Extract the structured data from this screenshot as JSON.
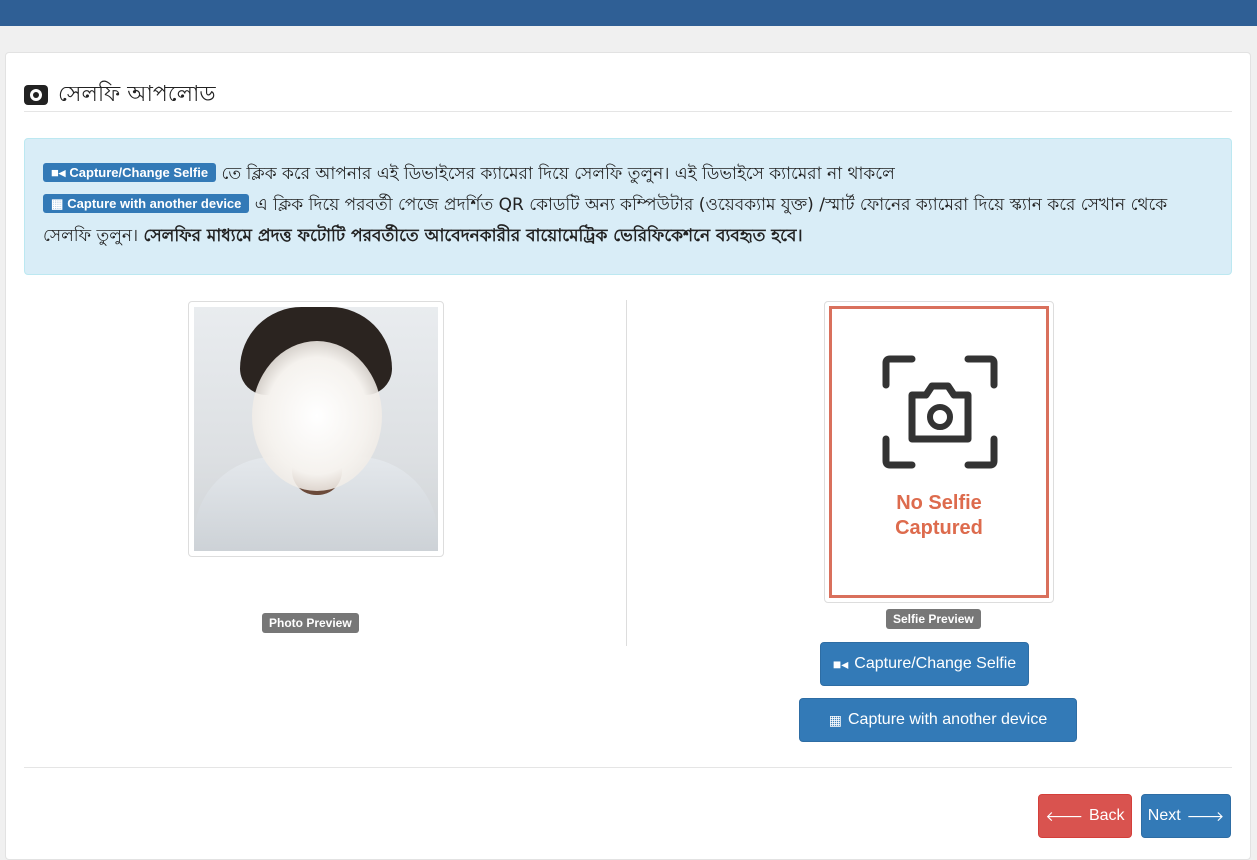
{
  "panel": {
    "title": "সেলফি আপলোড"
  },
  "info": {
    "tag_capture": "Capture/Change Selfie",
    "text_1": " তে ক্লিক করে আপনার এই ডিভাইসের ক্যামেরা দিয়ে সেলফি তুলুন। এই ডিভাইসে ক্যামেরা না থাকলে",
    "tag_another": "Capture with another device",
    "text_2": " এ ক্লিক দিয়ে পরবর্তী পেজে প্রদর্শিত QR কোডটি অন্য কম্পিউটার (ওয়েবক্যাম যুক্ত) /স্মার্ট ফোনের ক্যামেরা দিয়ে স্ক্যান করে সেখান থেকে সেলফি তুলুন। ",
    "bold_text": "সেলফির মাধ্যমে প্রদত্ত ফটোটি পরবর্তীতে আবেদনকারীর বায়োমেট্রিক ভেরিফিকেশনে ব্যবহৃত হবে।"
  },
  "photo": {
    "label": "Photo Preview"
  },
  "selfie": {
    "label": "Selfie Preview",
    "placeholder_line1": "No Selfie",
    "placeholder_line2": "Captured"
  },
  "buttons": {
    "capture": "Capture/Change Selfie",
    "another": "Capture with another device",
    "back": "Back",
    "next": "Next"
  },
  "colors": {
    "primary": "#337ab7",
    "danger": "#d9534f",
    "info_bg": "#d9edf7",
    "placeholder_accent": "#dd6b4d",
    "header": "#2f5f95"
  }
}
